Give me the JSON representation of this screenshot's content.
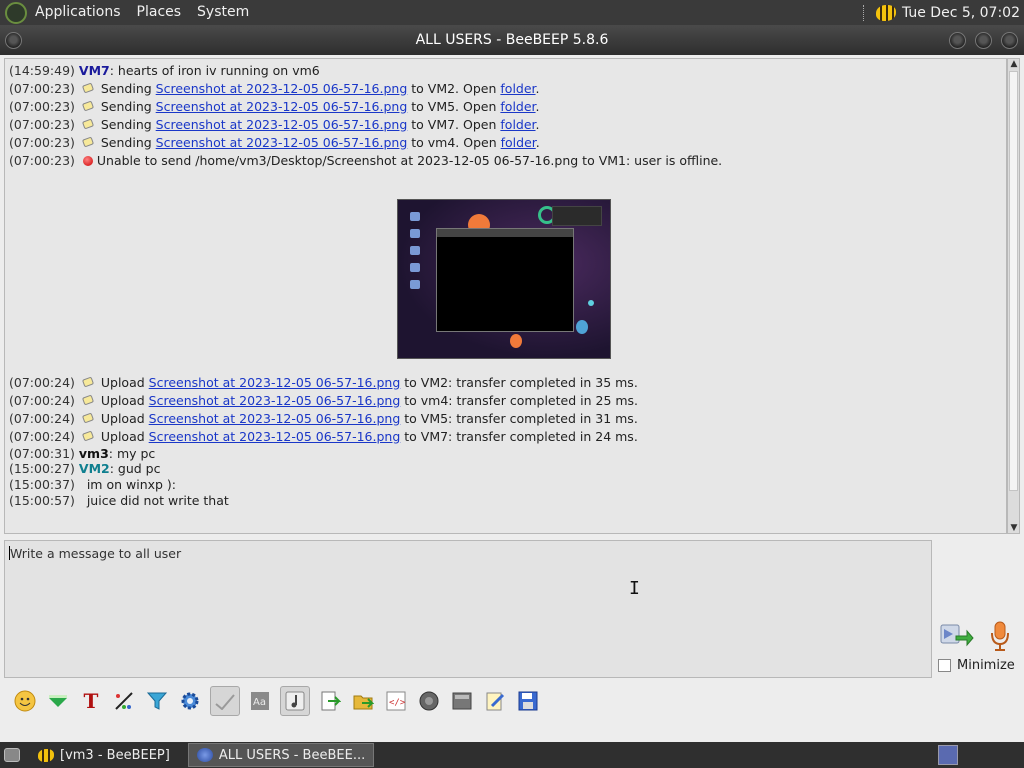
{
  "top_panel": {
    "menus": [
      "Applications",
      "Places",
      "System"
    ],
    "clock": "Tue Dec  5, 07:02"
  },
  "window": {
    "title": "ALL USERS - BeeBEEP 5.8.6"
  },
  "chat": {
    "lines": [
      {
        "time": "(14:59:49)",
        "user": "VM7",
        "sep": ":",
        "text": " hearts of iron iv running on vm6"
      },
      {
        "time": "(07:00:23)",
        "verb": "Sending",
        "file": "Screenshot at 2023-12-05 06-57-16.png",
        "dest": "to VM2. Open",
        "link": "folder",
        "end": "."
      },
      {
        "time": "(07:00:23)",
        "verb": "Sending",
        "file": "Screenshot at 2023-12-05 06-57-16.png",
        "dest": "to VM5. Open",
        "link": "folder",
        "end": "."
      },
      {
        "time": "(07:00:23)",
        "verb": "Sending",
        "file": "Screenshot at 2023-12-05 06-57-16.png",
        "dest": "to VM7. Open",
        "link": "folder",
        "end": "."
      },
      {
        "time": "(07:00:23)",
        "verb": "Sending",
        "file": "Screenshot at 2023-12-05 06-57-16.png",
        "dest": "to vm4. Open",
        "link": "folder",
        "end": "."
      },
      {
        "time": "(07:00:23)",
        "error": "Unable to send /home/vm3/Desktop/Screenshot at 2023-12-05 06-57-16.png to VM1: user is offline."
      }
    ],
    "uploads": [
      {
        "time": "(07:00:24)",
        "verb": "Upload",
        "file": "Screenshot at 2023-12-05 06-57-16.png",
        "rest": "to VM2: transfer completed in 35 ms."
      },
      {
        "time": "(07:00:24)",
        "verb": "Upload",
        "file": "Screenshot at 2023-12-05 06-57-16.png",
        "rest": "to vm4: transfer completed in 25 ms."
      },
      {
        "time": "(07:00:24)",
        "verb": "Upload",
        "file": "Screenshot at 2023-12-05 06-57-16.png",
        "rest": "to VM5: transfer completed in 31 ms."
      },
      {
        "time": "(07:00:24)",
        "verb": "Upload",
        "file": "Screenshot at 2023-12-05 06-57-16.png",
        "rest": "to VM7: transfer completed in 24 ms."
      }
    ],
    "messages": [
      {
        "time": "(07:00:31)",
        "user": "vm3",
        "text": ": my pc"
      },
      {
        "time": "(15:00:27)",
        "user": "VM2",
        "text": ": gud pc"
      },
      {
        "time": "(15:00:37)",
        "user": "",
        "text": "  im on winxp ):"
      },
      {
        "time": "(15:00:57)",
        "user": "",
        "text": "  juice did not write that"
      }
    ]
  },
  "input": {
    "placeholder": "Write a message to all user"
  },
  "minimize_label": "Minimize",
  "taskbar": {
    "items": [
      {
        "label": "[vm3 - BeeBEEP]"
      },
      {
        "label": "ALL USERS - BeeBEE..."
      }
    ]
  },
  "colors": {
    "panel": "#3a3a3a",
    "link": "#1a37c8",
    "vm7": "#1b1b9c",
    "vm2": "#0f7f8f"
  }
}
